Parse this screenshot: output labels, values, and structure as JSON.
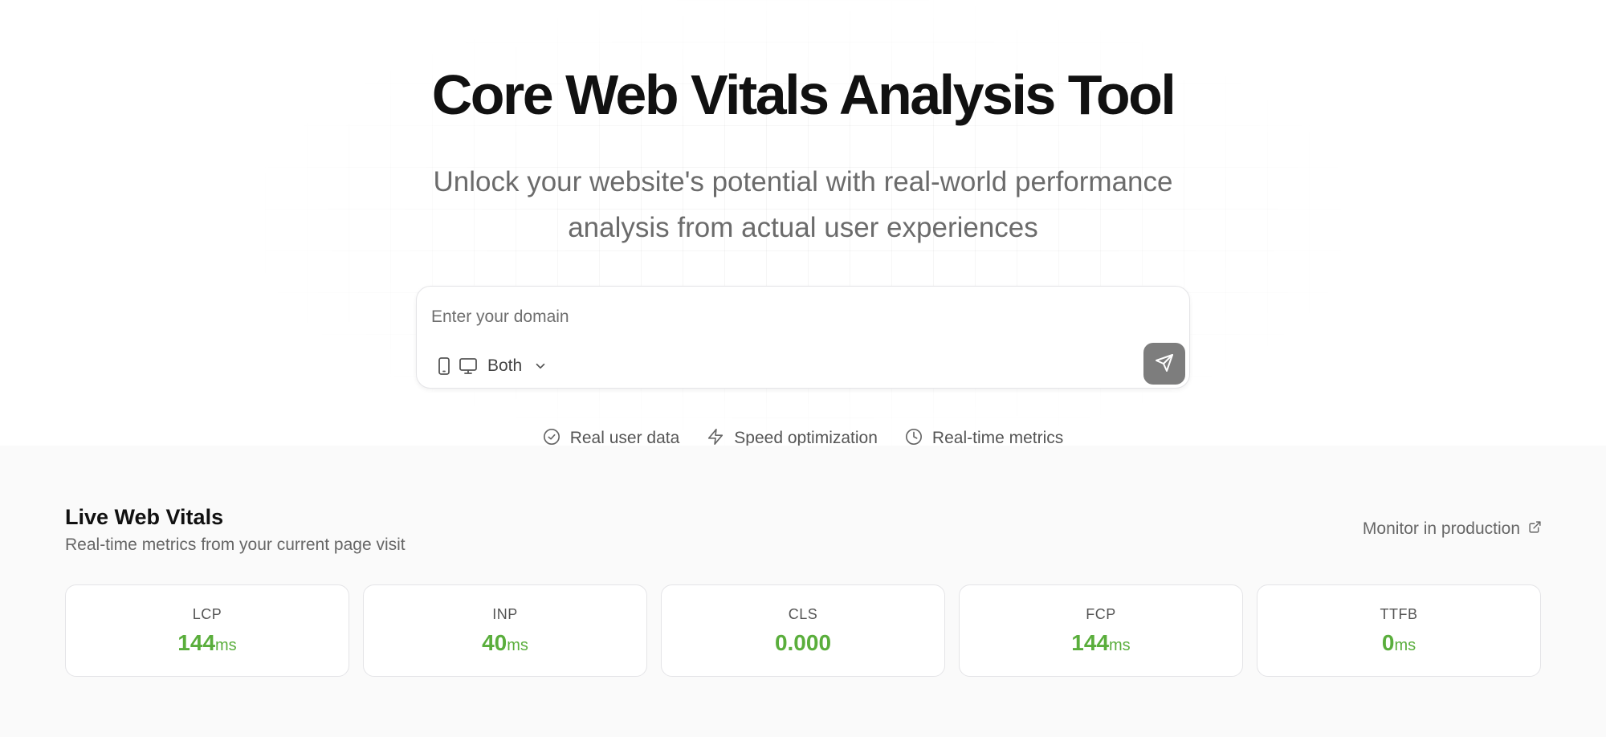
{
  "hero": {
    "title": "Core Web Vitals Analysis Tool",
    "subtitle_line1": "Unlock your website's potential with real-world performance",
    "subtitle_line2": "analysis from actual user experiences"
  },
  "search": {
    "placeholder": "Enter your domain",
    "value": "",
    "device_selected": "Both",
    "device_icons": [
      "phone-icon",
      "monitor-icon"
    ],
    "submit_icon": "send-icon"
  },
  "features": [
    {
      "icon": "check-circle-icon",
      "label": "Real user data"
    },
    {
      "icon": "lightning-icon",
      "label": "Speed optimization"
    },
    {
      "icon": "clock-icon",
      "label": "Real-time metrics"
    }
  ],
  "vitals": {
    "title": "Live Web Vitals",
    "subtitle": "Real-time metrics from your current page visit",
    "monitor_link": "Monitor in production",
    "metrics": [
      {
        "name": "LCP",
        "value": "144",
        "unit": "ms"
      },
      {
        "name": "INP",
        "value": "40",
        "unit": "ms"
      },
      {
        "name": "CLS",
        "value": "0.000",
        "unit": ""
      },
      {
        "name": "FCP",
        "value": "144",
        "unit": "ms"
      },
      {
        "name": "TTFB",
        "value": "0",
        "unit": "ms"
      }
    ]
  },
  "colors": {
    "good_metric": "#5aae3c",
    "submit_button": "#7d7d7d",
    "section_bg": "#fafafa"
  }
}
